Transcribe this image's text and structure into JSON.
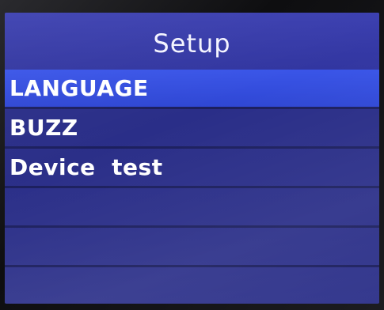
{
  "screen": {
    "title": "Setup",
    "selected_index": 0
  },
  "menu": {
    "items": [
      {
        "label": "LANGUAGE"
      },
      {
        "label": "BUZZ"
      },
      {
        "label": "Device  test"
      },
      {
        "label": ""
      },
      {
        "label": ""
      },
      {
        "label": ""
      }
    ]
  },
  "colors": {
    "background": "#2c3089",
    "header": "#3236a0",
    "selected_row": "#3a55e8",
    "separator": "#1c1f5e",
    "text": "#ffffff"
  }
}
